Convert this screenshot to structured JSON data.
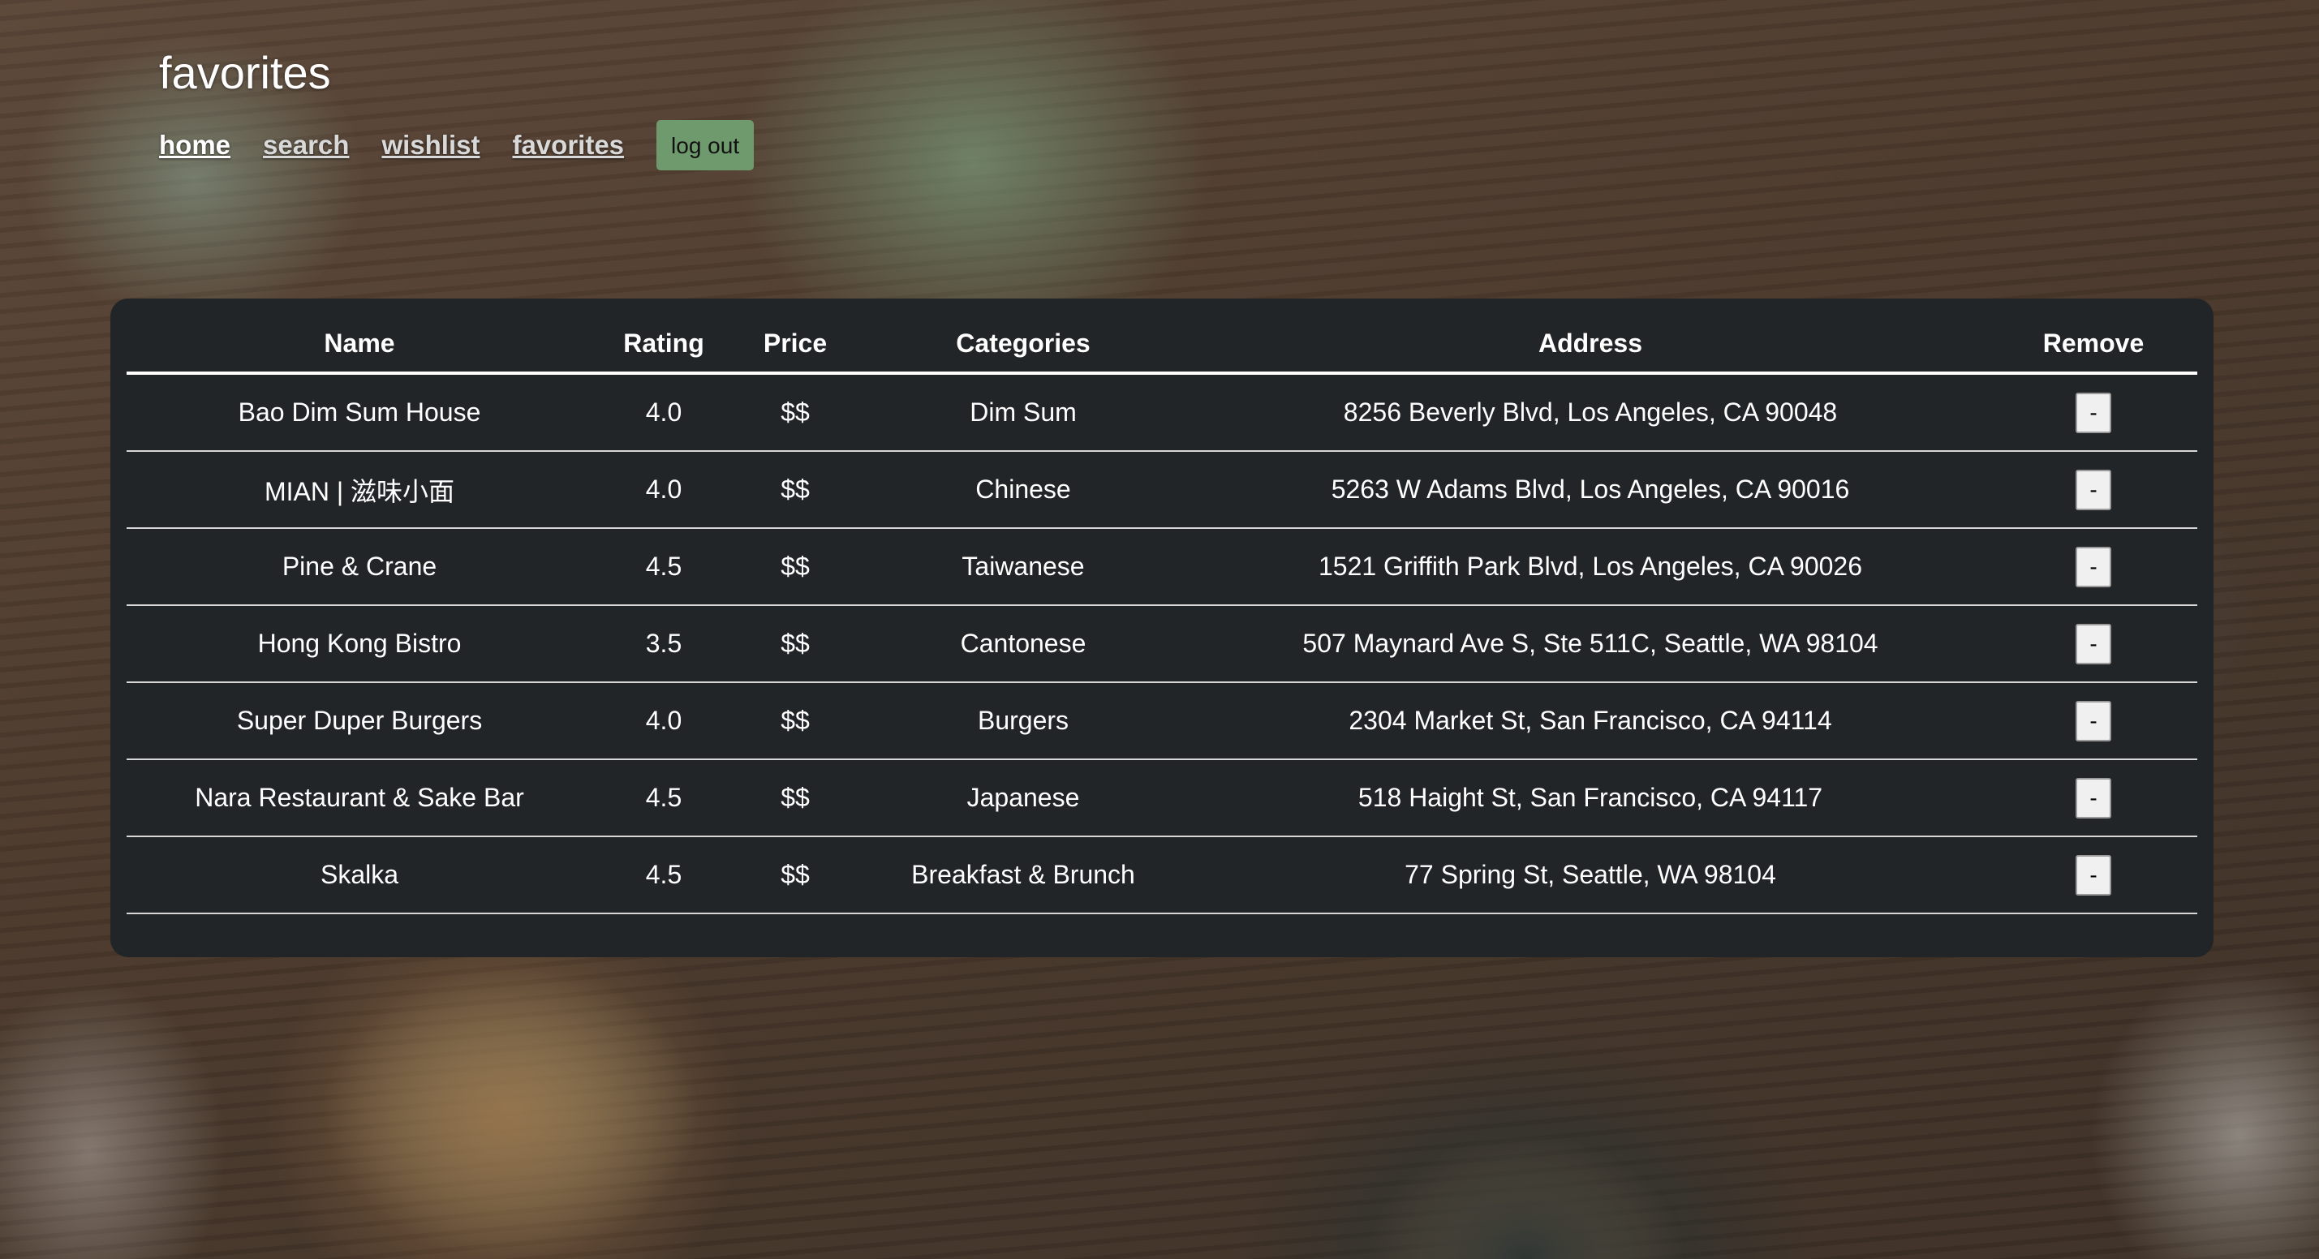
{
  "page": {
    "title": "favorites"
  },
  "nav": {
    "links": [
      {
        "label": "home"
      },
      {
        "label": "search"
      },
      {
        "label": "wishlist"
      },
      {
        "label": "favorites"
      }
    ],
    "logout_label": "log out"
  },
  "table": {
    "headers": {
      "name": "Name",
      "rating": "Rating",
      "price": "Price",
      "categories": "Categories",
      "address": "Address",
      "remove": "Remove"
    },
    "rows": [
      {
        "name": "Bao Dim Sum House",
        "rating": "4.0",
        "price": "$$",
        "categories": "Dim Sum",
        "address": "8256 Beverly Blvd, Los Angeles, CA 90048",
        "remove": "-"
      },
      {
        "name": "MIAN | 滋味小面",
        "rating": "4.0",
        "price": "$$",
        "categories": "Chinese",
        "address": "5263 W Adams Blvd, Los Angeles, CA 90016",
        "remove": "-"
      },
      {
        "name": "Pine & Crane",
        "rating": "4.5",
        "price": "$$",
        "categories": "Taiwanese",
        "address": "1521 Griffith Park Blvd, Los Angeles, CA 90026",
        "remove": "-"
      },
      {
        "name": "Hong Kong Bistro",
        "rating": "3.5",
        "price": "$$",
        "categories": "Cantonese",
        "address": "507 Maynard Ave S, Ste 511C, Seattle, WA 98104",
        "remove": "-"
      },
      {
        "name": "Super Duper Burgers",
        "rating": "4.0",
        "price": "$$",
        "categories": "Burgers",
        "address": "2304 Market St, San Francisco, CA 94114",
        "remove": "-"
      },
      {
        "name": "Nara Restaurant & Sake Bar",
        "rating": "4.5",
        "price": "$$",
        "categories": "Japanese",
        "address": "518 Haight St, San Francisco, CA 94117",
        "remove": "-"
      },
      {
        "name": "Skalka",
        "rating": "4.5",
        "price": "$$",
        "categories": "Breakfast & Brunch",
        "address": "77 Spring St, Seattle, WA 98104",
        "remove": "-"
      }
    ]
  },
  "colors": {
    "panel_background": "#212527",
    "logout_button": "#6f9a6e",
    "text": "#ffffff"
  }
}
